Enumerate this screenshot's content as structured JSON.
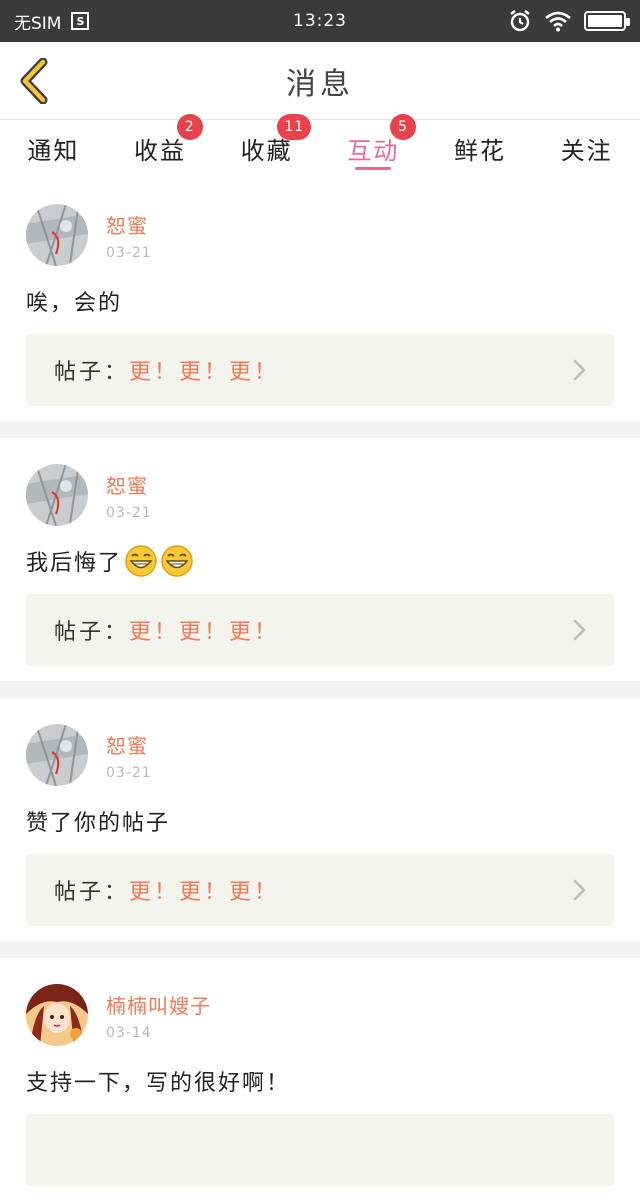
{
  "status_bar": {
    "carrier": "无SIM",
    "sim_icon_letter": "S",
    "time": "13:23",
    "battery_level": 1.0
  },
  "nav": {
    "title": "消息",
    "back_icon": "chevron-left-icon"
  },
  "tabs": [
    {
      "label": "通知",
      "badge": ""
    },
    {
      "label": "收益",
      "badge": "2"
    },
    {
      "label": "收藏",
      "badge": "11"
    },
    {
      "label": "互动",
      "badge": "5",
      "active": true
    },
    {
      "label": "鲜花",
      "badge": ""
    },
    {
      "label": "关注",
      "badge": ""
    }
  ],
  "colors": {
    "accent_pink": "#e86a92",
    "badge_red": "#e8424c",
    "name_orange": "#f07b57"
  },
  "items": [
    {
      "user": "恕蜜",
      "date": "03-21",
      "comment": "唉，会的",
      "emojis": 0,
      "post_prefix": "帖子：",
      "post_title": "更！更！更！"
    },
    {
      "user": "恕蜜",
      "date": "03-21",
      "comment": "我后悔了",
      "emojis": 2,
      "post_prefix": "帖子：",
      "post_title": "更！更！更！"
    },
    {
      "user": "恕蜜",
      "date": "03-21",
      "comment": "赞了你的帖子",
      "emojis": 0,
      "post_prefix": "帖子：",
      "post_title": "更！更！更！"
    },
    {
      "user": "楠楠叫嫂子",
      "date": "03-14",
      "comment": "支持一下，写的很好啊！",
      "emojis": 0,
      "post_prefix": "",
      "post_title": ""
    }
  ]
}
